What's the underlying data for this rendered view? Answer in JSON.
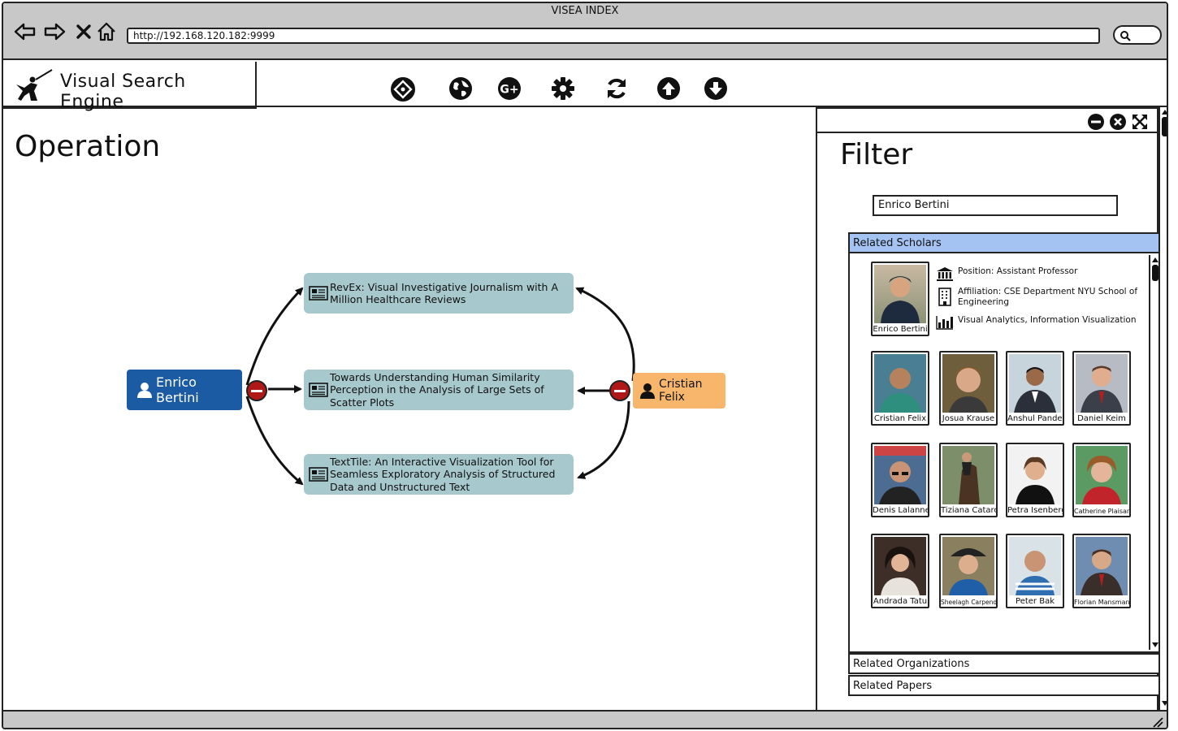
{
  "window": {
    "title": "VISEA INDEX",
    "url": "http://192.168.120.182:9999"
  },
  "app": {
    "title": "Visual Search Engine"
  },
  "toolbar": {
    "icons": [
      "graph-icon",
      "globe-icon",
      "google-plus-icon",
      "gear-icon",
      "refresh-icon",
      "arrow-up-icon",
      "arrow-down-icon"
    ]
  },
  "operation": {
    "title": "Operation",
    "source_node": "Enrico Bertini",
    "target_node": "Cristian Felix",
    "papers": [
      "RevEx: Visual Investigative Journalism with A Million Healthcare Reviews",
      "Towards Understanding Human Similarity Perception in the Analysis of Large Sets of Scatter Plots",
      "TextTile: An Interactive Visualization Tool for Seamless Exploratory Analysis of Structured Data and Unstructured Text"
    ],
    "colors": {
      "source": "#1b5ba3",
      "target": "#f7b66c",
      "paper": "#a7c8cc",
      "remove": "#b01818"
    }
  },
  "filter": {
    "title": "Filter",
    "query": "Enrico Bertini",
    "sections": {
      "scholars": "Related Scholars",
      "organizations": "Related Organizations",
      "papers": "Related Papers"
    },
    "selected": {
      "name": "Enrico Bertini",
      "position": "Position: Assistant Professor",
      "affiliation": "Affiliation: CSE Department NYU School of Engineering",
      "interests": "Visual Analytics, Information Visualization"
    },
    "scholars": [
      "Cristian Felix",
      "Josua Krause",
      "Anshul Pandey",
      "Daniel Keim",
      "Denis Lalanne",
      "Tiziana Catarc",
      "Petra Isenberg",
      "Catherine Plaisant",
      "Andrada Tatu",
      "Sheelagh Carpendale",
      "Peter Bak",
      "Florian Mansmann"
    ]
  }
}
